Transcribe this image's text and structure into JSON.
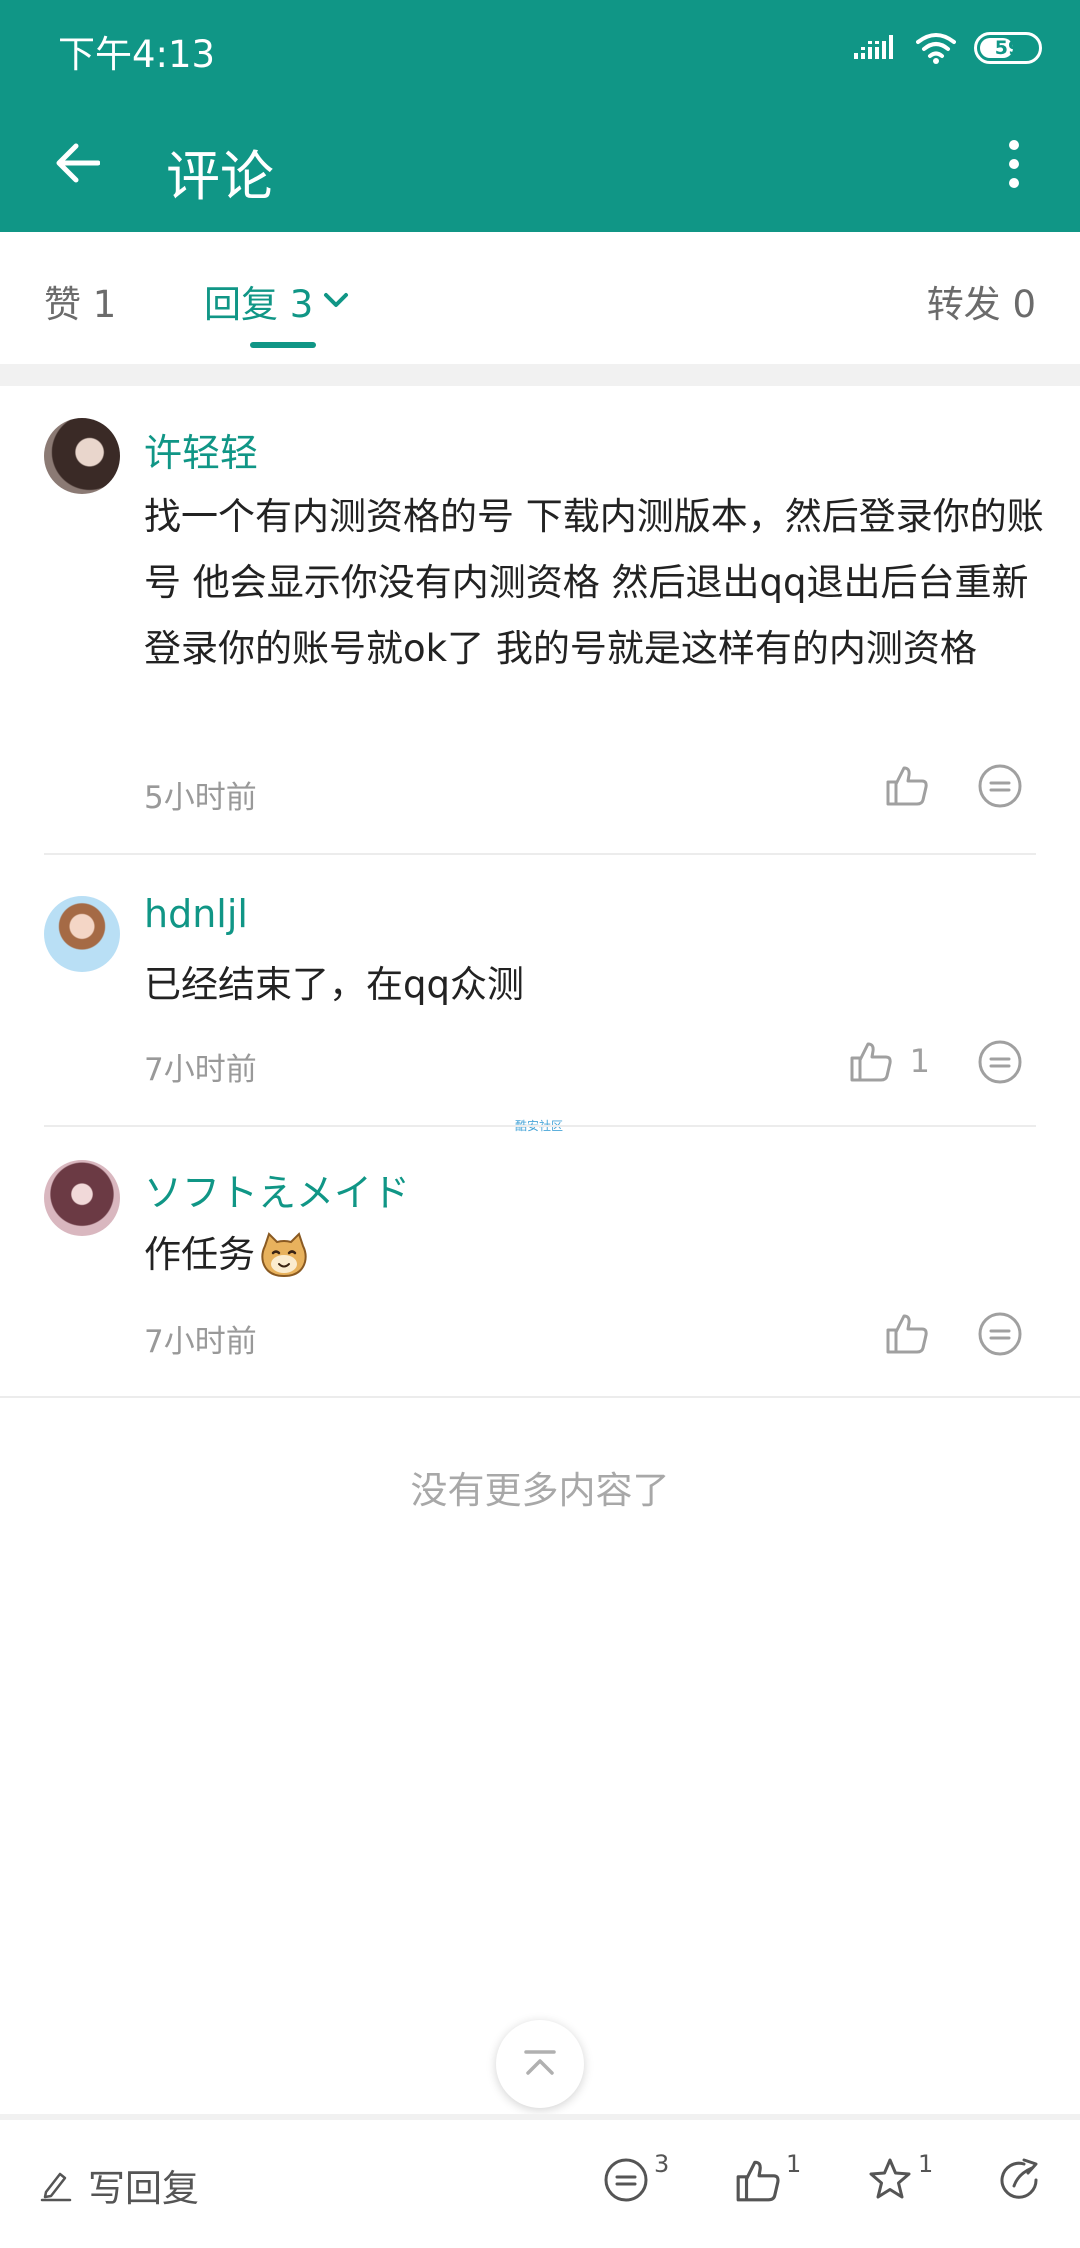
{
  "status_bar": {
    "time": "下午4:13",
    "battery": "59",
    "battery_level": 0.59
  },
  "header": {
    "title": "评论"
  },
  "tabs": {
    "likes": "赞 1",
    "replies": "回复 3",
    "forwards": "转发 0"
  },
  "comments": [
    {
      "author": "许轻轻",
      "text": "找一个有内测资格的号 下载内测版本，然后登录你的账号 他会显示你没有内测资格 然后退出qq退出后台重新登录你的账号就ok了 我的号就是这样有的内测资格",
      "time": "5小时前",
      "likes": ""
    },
    {
      "author": "hdnljl",
      "text": "已经结束了，在qq众测",
      "time": "7小时前",
      "likes": "1"
    },
    {
      "author": "ソフトえメイド",
      "text": "作任务",
      "time": "7小时前",
      "likes": ""
    }
  ],
  "watermark": "酷安社区",
  "footer_note": "没有更多内容了",
  "bottom_bar": {
    "write_reply": "写回复",
    "reply_count": "3",
    "like_count": "1",
    "favorite_count": "1"
  },
  "colors": {
    "accent": "#109686",
    "muted": "#999999"
  },
  "icons": [
    "back-arrow-icon",
    "more-vert-icon",
    "chevron-down-icon",
    "thumb-up-icon",
    "comment-bubble-icon",
    "pencil-icon",
    "star-icon",
    "share-icon",
    "arrow-up-icon",
    "signal-icon",
    "wifi-icon"
  ]
}
